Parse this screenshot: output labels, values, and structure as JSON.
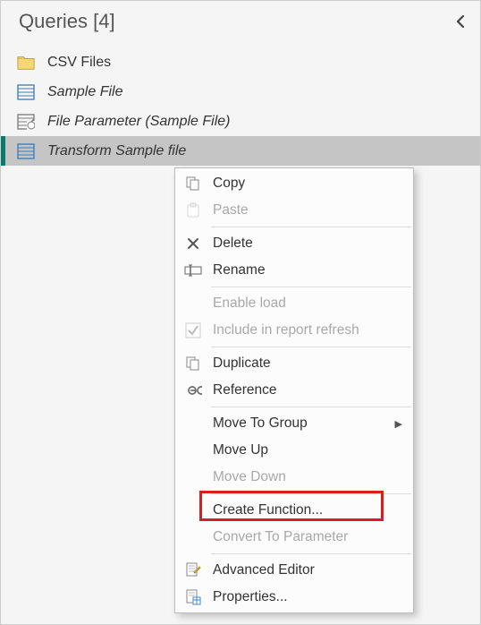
{
  "panel": {
    "title": "Queries [4]"
  },
  "queries": [
    {
      "label": "CSV Files",
      "icon": "folder",
      "italic": false,
      "selected": false
    },
    {
      "label": "Sample File",
      "icon": "doc",
      "italic": true,
      "selected": false
    },
    {
      "label": "File Parameter (Sample File)",
      "icon": "param",
      "italic": true,
      "selected": false
    },
    {
      "label": "Transform Sample file",
      "icon": "doc",
      "italic": true,
      "selected": true
    }
  ],
  "menu": {
    "copy": "Copy",
    "paste": "Paste",
    "delete": "Delete",
    "rename": "Rename",
    "enable_load": "Enable load",
    "include_refresh": "Include in report refresh",
    "duplicate": "Duplicate",
    "reference": "Reference",
    "move_group": "Move To Group",
    "move_up": "Move Up",
    "move_down": "Move Down",
    "create_function": "Create Function...",
    "convert_param": "Convert To Parameter",
    "advanced_editor": "Advanced Editor",
    "properties": "Properties..."
  },
  "highlight": "create_function"
}
